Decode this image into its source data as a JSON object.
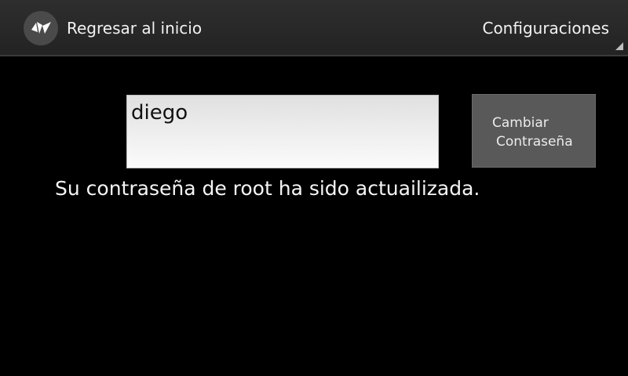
{
  "action_bar": {
    "app_icon": "kivy-logo-icon",
    "home_label": "Regresar al inicio",
    "settings_label": "Configuraciones",
    "overflow_indicator": "dropdown-corner-icon"
  },
  "form": {
    "password_value": "diego",
    "button_line1": "Cambiar",
    "button_line2": "Contraseña"
  },
  "status_message": "Su contraseña de root ha sido actuailizada.",
  "colors": {
    "background": "#000000",
    "action_bar": "#2a2a2a",
    "button": "#595959",
    "text": "#f2f2f2"
  }
}
